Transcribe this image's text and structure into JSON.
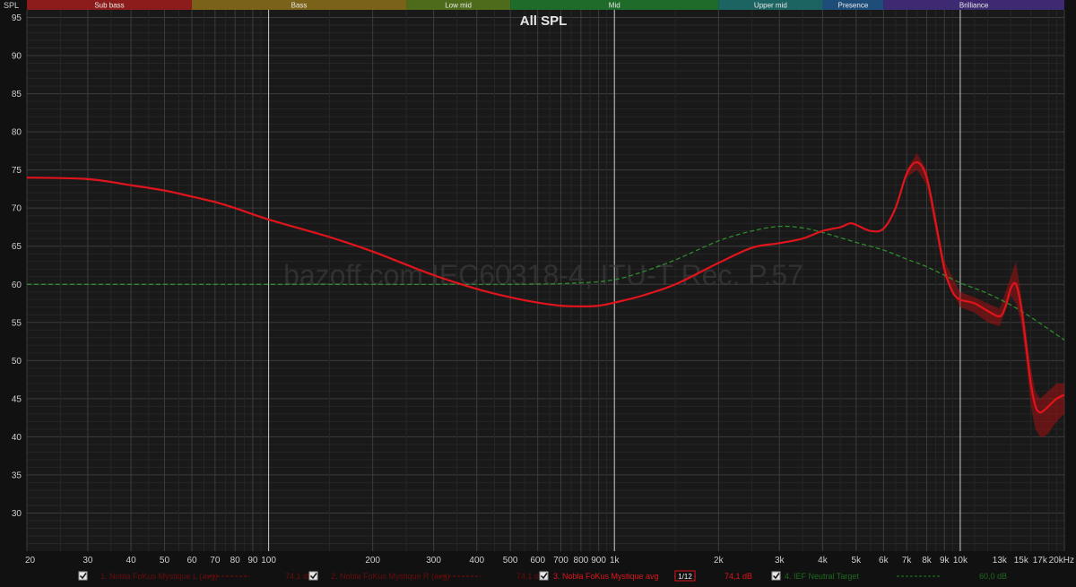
{
  "chart_data": {
    "type": "line",
    "title": "All SPL",
    "ylabel": "SPL",
    "xlabel": "",
    "x_scale": "log",
    "xlim": [
      20,
      20000
    ],
    "ylim": [
      25,
      96
    ],
    "grid": true,
    "watermark": "bazoff.com IEC60318-4, ITU-T Rec. P.57",
    "bands": [
      {
        "label": "Sub bass",
        "from": 20,
        "to": 60,
        "color": "#8c1c1c"
      },
      {
        "label": "Bass",
        "from": 60,
        "to": 250,
        "color": "#7a6318"
      },
      {
        "label": "Low mid",
        "from": 250,
        "to": 500,
        "color": "#4d6b1a"
      },
      {
        "label": "Mid",
        "from": 500,
        "to": 2000,
        "color": "#1f6b2a"
      },
      {
        "label": "Upper mid",
        "from": 2000,
        "to": 4000,
        "color": "#1c6461"
      },
      {
        "label": "Presence",
        "from": 4000,
        "to": 6000,
        "color": "#1f4d7a"
      },
      {
        "label": "Brilliance",
        "from": 6000,
        "to": 20000,
        "color": "#3d2a73"
      }
    ],
    "y_ticks": [
      "95",
      "90",
      "85",
      "80",
      "75",
      "70",
      "65",
      "60",
      "55",
      "50",
      "45",
      "40",
      "35",
      "30"
    ],
    "x_ticks": [
      {
        "v": 20,
        "label": "20"
      },
      {
        "v": 30,
        "label": "30"
      },
      {
        "v": 40,
        "label": "40"
      },
      {
        "v": 50,
        "label": "50"
      },
      {
        "v": 60,
        "label": "60"
      },
      {
        "v": 70,
        "label": "70"
      },
      {
        "v": 80,
        "label": "80"
      },
      {
        "v": 90,
        "label": "90"
      },
      {
        "v": 100,
        "label": "100"
      },
      {
        "v": 200,
        "label": "200"
      },
      {
        "v": 300,
        "label": "300"
      },
      {
        "v": 400,
        "label": "400"
      },
      {
        "v": 500,
        "label": "500"
      },
      {
        "v": 600,
        "label": "600"
      },
      {
        "v": 700,
        "label": "700"
      },
      {
        "v": 800,
        "label": "800"
      },
      {
        "v": 900,
        "label": "900"
      },
      {
        "v": 1000,
        "label": "1k"
      },
      {
        "v": 2000,
        "label": "2k"
      },
      {
        "v": 3000,
        "label": "3k"
      },
      {
        "v": 4000,
        "label": "4k"
      },
      {
        "v": 5000,
        "label": "5k"
      },
      {
        "v": 6000,
        "label": "6k"
      },
      {
        "v": 7000,
        "label": "7k"
      },
      {
        "v": 8000,
        "label": "8k"
      },
      {
        "v": 9000,
        "label": "9k"
      },
      {
        "v": 10000,
        "label": "10k"
      },
      {
        "v": 13000,
        "label": "13k"
      },
      {
        "v": 15000,
        "label": "15k"
      },
      {
        "v": 17000,
        "label": "17k"
      },
      {
        "v": 20000,
        "label": "20kHz"
      }
    ],
    "series": [
      {
        "name": "3. Nobla FoKus Mystique avg",
        "color": "#e0141c",
        "style": "solid",
        "x": [
          20,
          30,
          40,
          50,
          60,
          70,
          80,
          100,
          150,
          200,
          300,
          400,
          500,
          600,
          700,
          800,
          900,
          1000,
          1200,
          1500,
          2000,
          2500,
          3000,
          3500,
          4000,
          4500,
          4800,
          5000,
          5500,
          6000,
          6500,
          7000,
          7500,
          8000,
          8500,
          9000,
          9500,
          10000,
          11000,
          12000,
          13000,
          13500,
          14000,
          14500,
          15000,
          15500,
          16000,
          16500,
          17000,
          17500,
          18000,
          19000,
          20000
        ],
        "y": [
          74,
          73.8,
          73,
          72.3,
          71.5,
          70.8,
          70,
          68.5,
          66.2,
          64.3,
          61.2,
          59.4,
          58.3,
          57.6,
          57.2,
          57.1,
          57.2,
          57.6,
          58.5,
          60,
          62.8,
          64.8,
          65.4,
          66,
          67,
          67.5,
          68,
          67.8,
          67,
          67.3,
          70,
          74.5,
          76,
          74,
          68,
          62,
          59,
          58,
          57.5,
          56.5,
          55.8,
          57,
          59.5,
          60,
          57,
          52,
          47,
          44,
          43.2,
          43.5,
          44,
          45,
          45.5
        ]
      },
      {
        "name": "4. IEF Neutral Target",
        "color": "#2e8a2e",
        "style": "dashed",
        "x": [
          20,
          100,
          500,
          800,
          1000,
          1200,
          1500,
          2000,
          2500,
          3000,
          3500,
          4000,
          5000,
          6000,
          7000,
          8000,
          10000,
          12000,
          15000,
          20000
        ],
        "y": [
          60,
          60,
          60,
          60.2,
          60.6,
          61.6,
          63.2,
          65.7,
          67,
          67.6,
          67.4,
          66.8,
          65.5,
          64.5,
          63.3,
          62.3,
          60.2,
          58.8,
          56.5,
          52.7
        ]
      }
    ],
    "envelope": {
      "name": "range",
      "color": "#a01010",
      "x": [
        7000,
        7500,
        8000,
        9000,
        10000,
        11000,
        12000,
        13000,
        14000,
        14500,
        15000,
        15500,
        16000,
        16500,
        17000,
        17500,
        18000,
        19000,
        20000
      ],
      "upper": [
        75,
        77.2,
        75,
        63,
        59,
        58.3,
        57.5,
        56.8,
        61,
        63,
        58.5,
        54,
        49,
        46,
        45,
        45.5,
        46,
        47,
        47
      ],
      "lower": [
        74,
        75,
        73,
        61,
        57,
        56.3,
        55,
        54.5,
        58.5,
        57.5,
        55,
        50,
        44,
        41,
        40,
        40,
        40.5,
        42,
        43
      ]
    }
  },
  "legend": [
    {
      "checked": true,
      "label": "1. Nobla FoKus Mystique L (avg)",
      "value": "74,1 dB",
      "color": "#6a0c0c"
    },
    {
      "checked": true,
      "label": "2. Nobla FoKus Mystique R (avg)",
      "value": "74,1 dB",
      "color": "#6a0c0c"
    },
    {
      "checked": true,
      "label": "3. Nobla FoKus Mystique avg",
      "value": "74,1 dB",
      "color": "#e0141c",
      "smoothing": "1/12"
    },
    {
      "checked": true,
      "label": "4. IEF Neutral Target",
      "value": "60,0 dB",
      "color": "#1e6a1e"
    }
  ]
}
